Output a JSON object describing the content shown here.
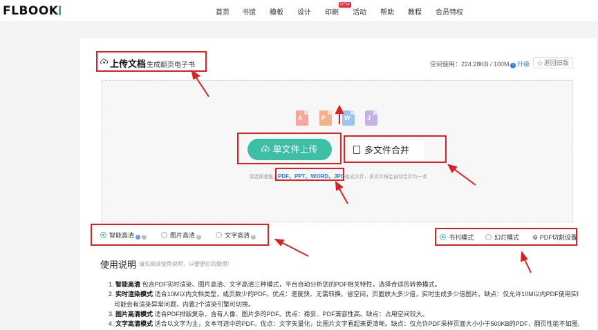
{
  "logo": "FLBOOK",
  "nav": [
    "首页",
    "书馆",
    "模板",
    "设计",
    "印刷",
    "活动",
    "帮助",
    "教程",
    "会员特权"
  ],
  "nav_badge": "NEW",
  "header": {
    "title": "上传文档",
    "subtitle": "生成翻页电子书"
  },
  "quota": {
    "text": "空间使用：224.28KB / 100M",
    "upgrade": "升级",
    "back": "返回旧版"
  },
  "file_types": {
    "pdf": "A",
    "ppt": "P",
    "word": "W",
    "jpg": "J"
  },
  "upload": {
    "single": "单文件上传",
    "multi": "多文件合并",
    "hint_pre": "请选择或拖入",
    "formats": "PDF、PPT、WORD、JPG",
    "hint_post": "格式文件，多文件将会自动合并为一本"
  },
  "quality": {
    "options": [
      "智能高清",
      "图片高清",
      "文字高清"
    ]
  },
  "mode": {
    "options": [
      "书刊模式",
      "幻灯模式"
    ],
    "pdf_settings": "PDF切割设置"
  },
  "manual": {
    "title": "使用说明",
    "subtitle": "请先阅读使用说明，以便更好的使用！",
    "items": [
      {
        "num": "1.",
        "name": "智能高清",
        "text": "包含PDF实时渲染、图片高清、文字高清三种模式，平台自动分析您的PDF相关特性，选择合适的转换模式。"
      },
      {
        "num": "2.",
        "name": "实时渲染模式",
        "text": "适合10M以内文档类型，或页数少的PDF。优点：速度快、无需转换、省空间，页面放大多少倍，实时生成多少倍图片。缺点：仅允许10M以内PDF使用实时渲染模式，"
      },
      {
        "num": "",
        "name": "",
        "text": "可能会有渲染异常问题，内置2个渲染引擎可切换。"
      },
      {
        "num": "3.",
        "name": "图片高清模式",
        "text": "适合PDF排版复杂，含有人像、图片多的PDF。优点：稳妥、PDF兼容性高。缺点：占用空间较大。"
      },
      {
        "num": "4.",
        "name": "文字高清模式",
        "text": "适合以文字为主，文本可选中的PDF。优点：文字矢量化，比图片文字看起来更清晰。缺点：仅允许PDF采样页面大小小于500KB的PDF，翻页性能不如图片页面，略"
      }
    ]
  },
  "colors": {
    "accent": "#3dbfa6",
    "link": "#2f7de1",
    "annotation": "#e02020"
  }
}
